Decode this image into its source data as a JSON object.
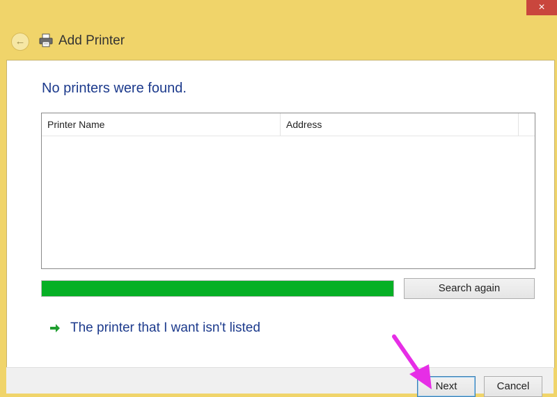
{
  "window": {
    "title": "Add Printer",
    "close_glyph": "×",
    "back_glyph": "←"
  },
  "main": {
    "heading": "No printers were found.",
    "list": {
      "columns": [
        "Printer Name",
        "Address"
      ],
      "rows": []
    },
    "progress": {
      "fraction": 1.0,
      "color": "#06b025"
    },
    "search_again_label": "Search again",
    "not_listed_link": "The printer that I want isn't listed"
  },
  "footer": {
    "next_label": "Next",
    "cancel_label": "Cancel"
  },
  "colors": {
    "title_bar": "#f0d46a",
    "heading_text": "#1c3a8c",
    "close_button": "#c9463d",
    "annotation_arrow": "#e62ee6"
  },
  "icons": {
    "back": "back-arrow-icon",
    "printer": "printer-icon",
    "link_arrow": "green-arrow-icon",
    "annotation": "pointer-arrow-annotation"
  }
}
